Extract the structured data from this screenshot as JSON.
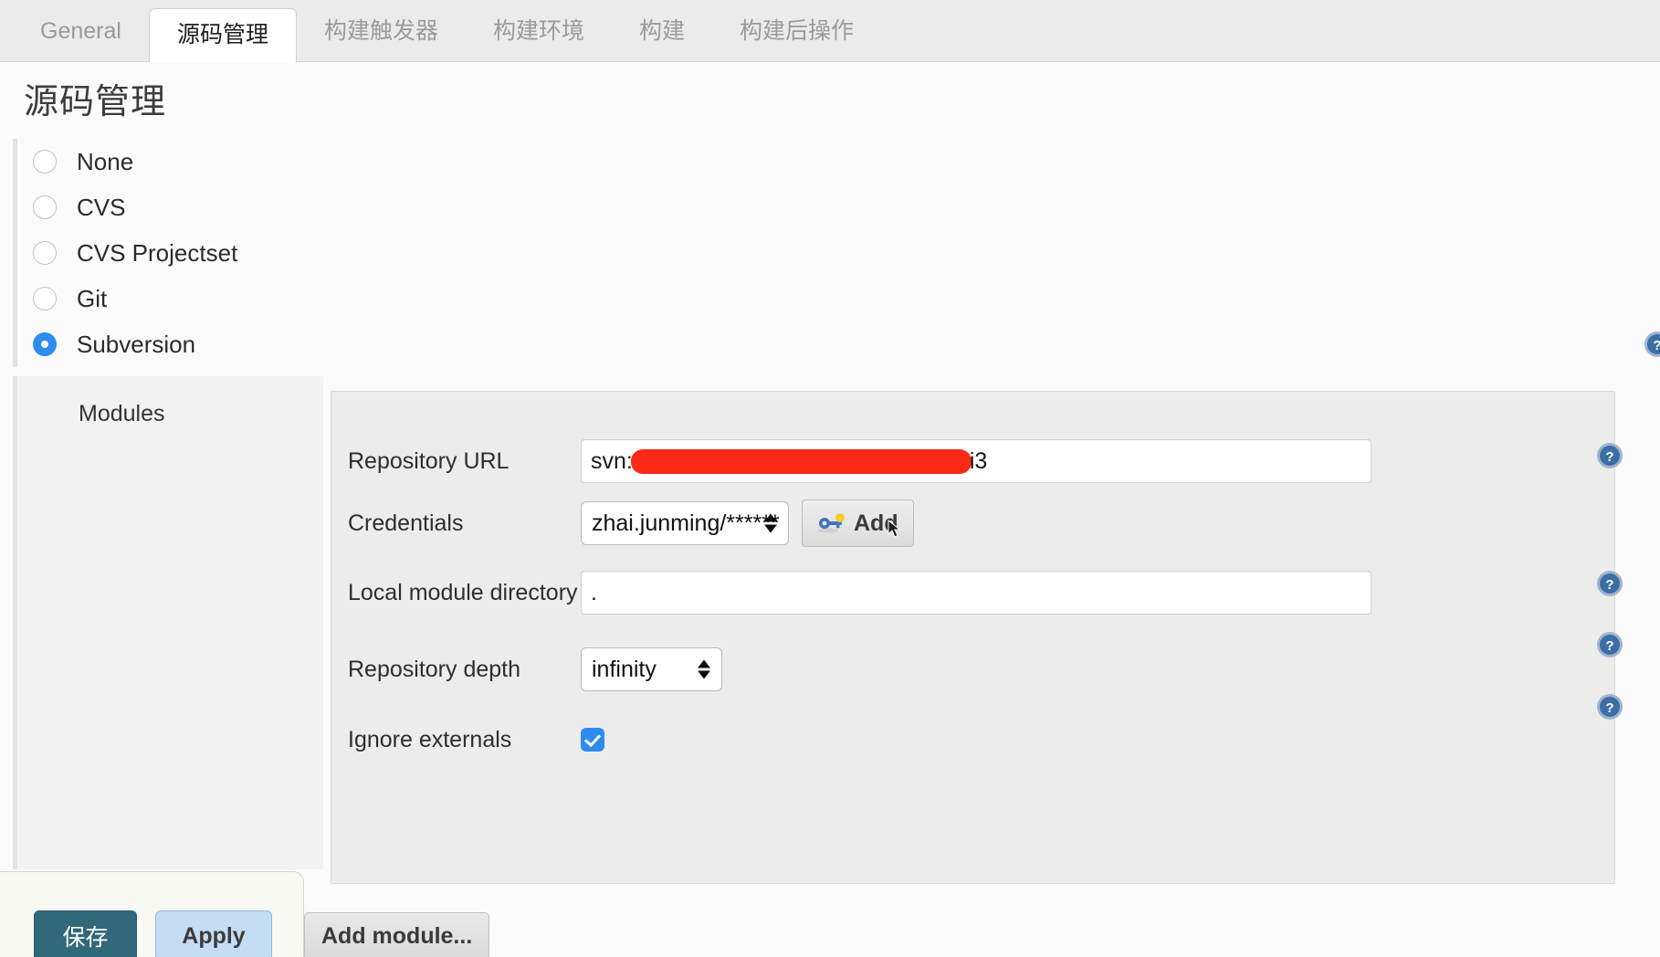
{
  "tabs": [
    {
      "label": "General",
      "active": false
    },
    {
      "label": "源码管理",
      "active": true
    },
    {
      "label": "构建触发器",
      "active": false
    },
    {
      "label": "构建环境",
      "active": false
    },
    {
      "label": "构建",
      "active": false
    },
    {
      "label": "构建后操作",
      "active": false
    }
  ],
  "page": {
    "title": "源码管理"
  },
  "scm": {
    "options": [
      {
        "label": "None",
        "checked": false
      },
      {
        "label": "CVS",
        "checked": false
      },
      {
        "label": "CVS Projectset",
        "checked": false
      },
      {
        "label": "Git",
        "checked": false
      },
      {
        "label": "Subversion",
        "checked": true
      }
    ]
  },
  "modules": {
    "section_label": "Modules",
    "fields": {
      "repository_url": {
        "label": "Repository URL",
        "prefix": "svn:",
        "redacted": true,
        "suffix": "i3",
        "help": "?"
      },
      "credentials": {
        "label": "Credentials",
        "value": "zhai.junming/******",
        "add_button": "Add",
        "add_icon": "key-icon"
      },
      "local_module_directory": {
        "label": "Local module directory",
        "value": ".",
        "placeholder": "",
        "help": "?"
      },
      "repository_depth": {
        "label": "Repository depth",
        "value": "infinity",
        "help": "?"
      },
      "ignore_externals": {
        "label": "Ignore externals",
        "checked": true,
        "help": "?"
      }
    },
    "add_module_button": "Add module..."
  },
  "action_bar": {
    "save_label": "保存",
    "apply_label": "Apply"
  },
  "colors": {
    "accent_blue": "#2e8bf0",
    "redaction_red": "#fb2a16",
    "save_teal": "#31687a",
    "apply_blue": "#c5ddf2",
    "help_blue": "#3b6ea5"
  }
}
